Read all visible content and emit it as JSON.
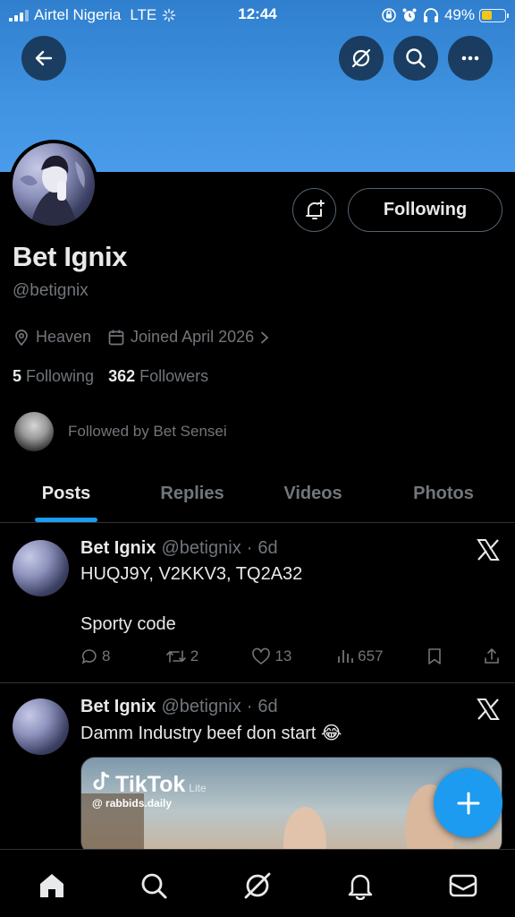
{
  "status_bar": {
    "carrier": "Airtel Nigeria",
    "network": "LTE",
    "time": "12:44",
    "battery": "49%"
  },
  "header_icons": [
    "back-arrow-icon",
    "grok-icon",
    "search-icon",
    "more-icon"
  ],
  "profile": {
    "name": "Bet Ignix",
    "handle": "@betignix",
    "location": "Heaven",
    "joined": "Joined April 2026",
    "following_count": "5",
    "following_label": "Following",
    "followers_count": "362",
    "followers_label": "Followers",
    "followed_by": "Followed by Bet Sensei",
    "follow_button": "Following"
  },
  "tabs": [
    {
      "label": "Posts",
      "active": true
    },
    {
      "label": "Replies",
      "active": false
    },
    {
      "label": "Videos",
      "active": false
    },
    {
      "label": "Photos",
      "active": false
    }
  ],
  "posts": [
    {
      "name": "Bet Ignix",
      "handle": "@betignix",
      "age": "6d",
      "line1": "HUQJ9Y, V2KKV3, TQ2A32",
      "line2": "Sporty code",
      "replies": "8",
      "reposts": "2",
      "likes": "13",
      "views": "657"
    },
    {
      "name": "Bet Ignix",
      "handle": "@betignix",
      "age": "6d",
      "line1": "Damm Industry beef don start 😂",
      "video": {
        "brand": "TikTok",
        "brand_sub": "Lite",
        "account": "@ rabbids.daily"
      }
    }
  ],
  "bottom_nav": [
    "home-icon",
    "search-icon",
    "grok-icon",
    "notifications-icon",
    "messages-icon"
  ],
  "colors": {
    "accent": "#1d9bf0",
    "background": "#000000",
    "muted": "#71767b",
    "text": "#e7e9ea"
  }
}
